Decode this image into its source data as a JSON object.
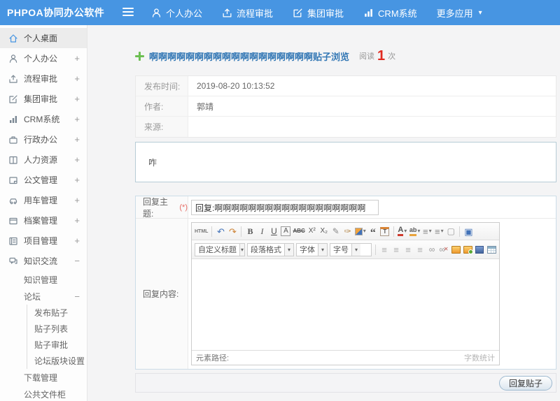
{
  "topbar": {
    "logo": "PHPOA协同办公软件",
    "items": [
      {
        "label": "个人办公",
        "icon": "user-icon"
      },
      {
        "label": "流程审批",
        "icon": "workflow-icon"
      },
      {
        "label": "集团审批",
        "icon": "group-approval-icon"
      },
      {
        "label": "CRM系统",
        "icon": "crm-chart-icon"
      },
      {
        "label": "更多应用",
        "icon": "caret-down-icon"
      }
    ]
  },
  "sidebar": {
    "items": [
      {
        "label": "个人桌面",
        "icon": "home-icon"
      },
      {
        "label": "个人办公",
        "icon": "user-icon",
        "expander": "+"
      },
      {
        "label": "流程审批",
        "icon": "workflow-icon",
        "expander": "+"
      },
      {
        "label": "集团审批",
        "icon": "group-approval-icon",
        "expander": "+"
      },
      {
        "label": "CRM系统",
        "icon": "crm-chart-icon",
        "expander": "+"
      },
      {
        "label": "行政办公",
        "icon": "admin-office-icon",
        "expander": "+"
      },
      {
        "label": "人力资源",
        "icon": "hr-book-icon",
        "expander": "+"
      },
      {
        "label": "公文管理",
        "icon": "document-icon",
        "expander": "+"
      },
      {
        "label": "用车管理",
        "icon": "vehicle-icon",
        "expander": "+"
      },
      {
        "label": "档案管理",
        "icon": "archive-icon",
        "expander": "+"
      },
      {
        "label": "项目管理",
        "icon": "project-icon",
        "expander": "+"
      },
      {
        "label": "知识交流",
        "icon": "knowledge-icon",
        "expander": "−"
      }
    ],
    "submenu": {
      "knowledge_manage": "知识管理",
      "forum": "论坛",
      "forum_expander": "−",
      "forum_children": [
        "发布贴子",
        "贴子列表",
        "贴子审批",
        "论坛版块设置"
      ],
      "download_manage": "下载管理",
      "public_cabinet": "公共文件柜"
    }
  },
  "main": {
    "title": {
      "text": "啊啊啊啊啊啊啊啊啊啊啊啊啊啊啊啊啊啊贴子浏览",
      "read_label": "阅读",
      "read_count": "1",
      "read_unit": "次"
    },
    "info": {
      "rows": [
        {
          "label": "发布时间:",
          "value": "2019-08-20 10:13:52"
        },
        {
          "label": "作者:",
          "value": "郭靖"
        },
        {
          "label": "来源:",
          "value": ""
        }
      ],
      "content": "咋"
    },
    "reply": {
      "subject_label": "回复主题:",
      "required_mark": "(*)",
      "subject_value": "回复:啊啊啊啊啊啊啊啊啊啊啊啊啊啊啊啊啊啊",
      "content_label": "回复内容:",
      "submit_label": "回复贴子"
    }
  },
  "editor": {
    "toolbar1": {
      "source": "HTML",
      "undo": "↶",
      "redo": "↷",
      "bold": "B",
      "italic": "I",
      "underline": "U",
      "removeformat": "A",
      "strike": "ABC",
      "sup": "X²",
      "sub": "X₂",
      "eraser": "✎",
      "brush": "✑",
      "quote": "“",
      "datebox": "T",
      "fontcolor": "A",
      "hilite": "ab",
      "ol": "≡",
      "ul": "≡",
      "page": "▢",
      "fullscreen": "▣",
      "caret": "▾"
    },
    "toolbar2": {
      "heading_select": "自定义标题",
      "paragraph_select": "段落格式",
      "font_select": "字体",
      "size_select": "字号",
      "caret": "▾",
      "align": "≡",
      "link": "∞",
      "unlink_x": "✕"
    },
    "statusbar": {
      "left": "元素路径:",
      "right": "字数统计"
    }
  },
  "colors": {
    "topbar_blue": "#4795e2",
    "title_blue": "#3478b5",
    "read_red": "#e02a20",
    "add_green": "#6cbf52",
    "page_bg": "#f4f4f5"
  }
}
